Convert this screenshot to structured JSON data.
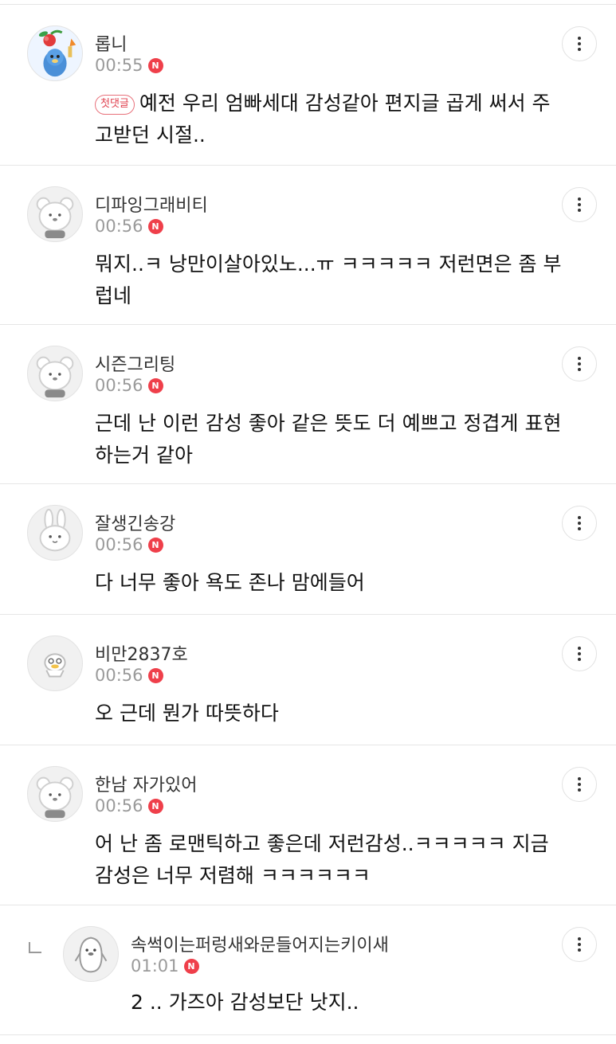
{
  "comments": [
    {
      "author": "롭니",
      "time": "00:55",
      "badge": "N",
      "first_label": "첫댓글",
      "text": "예전 우리 엄빠세대 감성같아 편지글 곱게 써서 주고받던 시절..",
      "avatar_icon": "cherry-character-avatar-icon"
    },
    {
      "author": "디파잉그래비티",
      "time": "00:56",
      "badge": "N",
      "text": "뭐지..ㅋ 낭만이살아있노...ㅠ ㅋㅋㅋㅋㅋ 저런면은 좀 부럽네",
      "avatar_icon": "default-bear-avatar-icon"
    },
    {
      "author": "시즌그리팅",
      "time": "00:56",
      "badge": "N",
      "text": "근데 난 이런 감성 좋아 같은 뜻도 더 예쁘고 정겹게 표현하는거 같아",
      "avatar_icon": "default-bear-avatar-icon"
    },
    {
      "author": "잘생긴송강",
      "time": "00:56",
      "badge": "N",
      "text": "다 너무 좋아 욕도 존나 맘에들어",
      "avatar_icon": "rabbit-avatar-icon"
    },
    {
      "author": "비만2837호",
      "time": "00:56",
      "badge": "N",
      "text": "오 근데 뭔가 따뜻하다",
      "avatar_icon": "duck-avatar-icon"
    },
    {
      "author": "한남 자가있어",
      "time": "00:56",
      "badge": "N",
      "text": "어 난 좀 로맨틱하고 좋은데 저런감성..ㅋㅋㅋㅋㅋ 지금 감성은 너무 저렴해 ㅋㅋㅋㅋㅋㅋ",
      "avatar_icon": "default-bear-avatar-icon"
    },
    {
      "author": "속썩이는퍼렁새와문들어지는키이새",
      "time": "01:01",
      "badge": "N",
      "text": "2 .. 가즈아 감성보단 낫지..",
      "avatar_icon": "penguin-avatar-icon",
      "is_reply": true
    }
  ],
  "more_icon": "more-vertical-icon",
  "colors": {
    "badge": "#ef3f4a",
    "time": "#9a9a9a",
    "divider": "#e6e6e6",
    "first_badge": "#e0404e"
  }
}
